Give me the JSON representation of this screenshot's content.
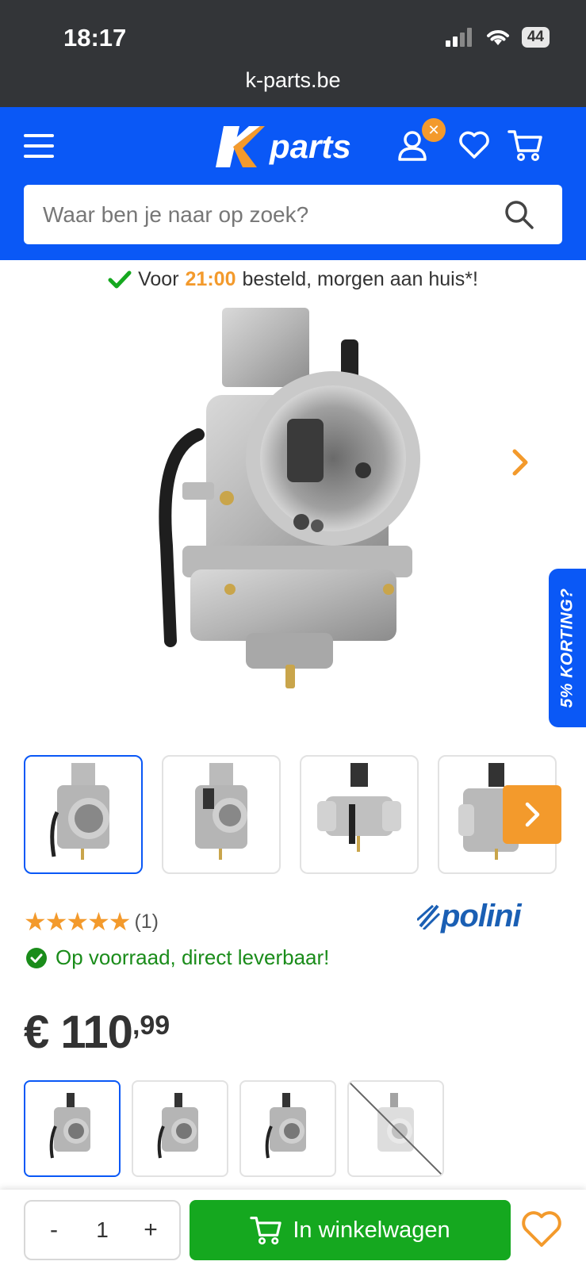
{
  "status": {
    "time": "18:17",
    "battery": "44"
  },
  "browser": {
    "url": "k-parts.be"
  },
  "header": {
    "logo_text": "parts",
    "badge": "✕",
    "search_placeholder": "Waar ben je naar op zoek?"
  },
  "promo": {
    "prefix": "Voor",
    "time": "21:00",
    "suffix": "besteld, morgen aan huis*!"
  },
  "side_tab": {
    "label": "5% KORTING?"
  },
  "product": {
    "rating_stars": "★★★★★",
    "rating_count": "(1)",
    "brand": "polini",
    "stock": "Op voorraad, direct leverbaar!",
    "price_main": "€ 110",
    "price_cents": ",99"
  },
  "bottom_bar": {
    "minus": "-",
    "quantity": "1",
    "plus": "+",
    "cart_label": "In winkelwagen"
  },
  "colors": {
    "brand_blue": "#0a58f6",
    "accent_orange": "#f39a2c",
    "cart_green": "#15a81f",
    "stock_green": "#1a8c1a"
  }
}
